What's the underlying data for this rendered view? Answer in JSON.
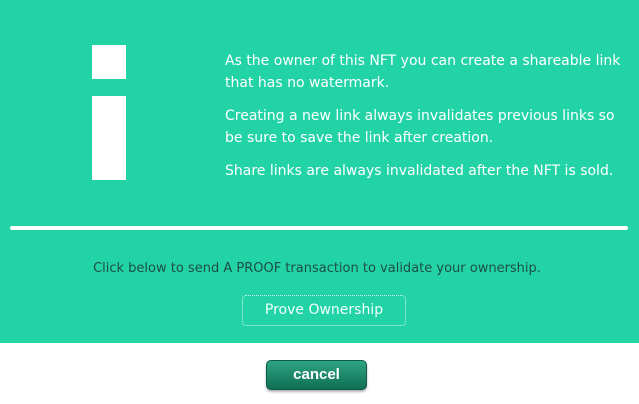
{
  "dialog": {
    "icon": "info-icon",
    "notes": [
      "As the owner of this NFT you can create a shareable link that has no watermark.",
      "Creating a new link always invalidates previous links so be sure to save the link after creation.",
      "Share links are always invalidated after the NFT is sold."
    ],
    "instruction": "Click below to send A PROOF transaction to validate your ownership.",
    "prove_button_label": "Prove Ownership",
    "cancel_button_label": "cancel"
  },
  "colors": {
    "panel_background": "#22d3a6",
    "page_background": "#ffffff",
    "cancel_button": "#1a8a6a"
  }
}
